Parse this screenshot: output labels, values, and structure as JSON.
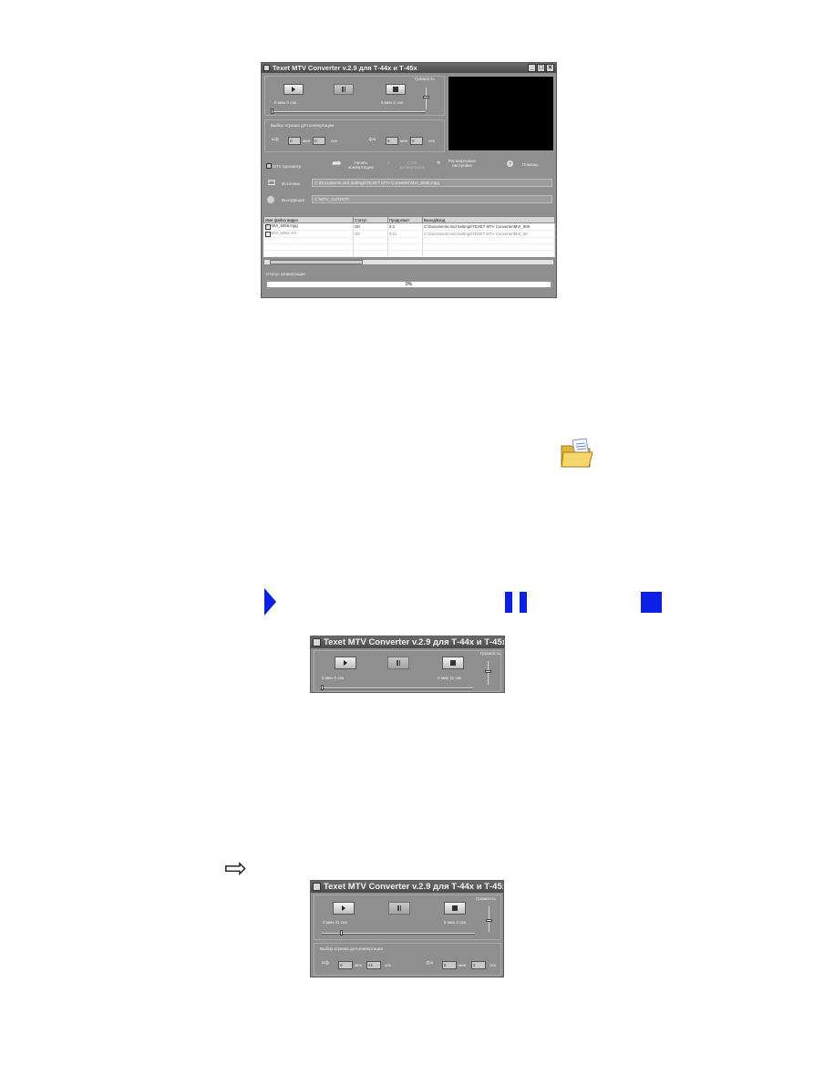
{
  "main_window": {
    "title": "Texet MTV Converter v.2.9 для Т-44х и Т-45х",
    "window_controls": {
      "minimize": "_",
      "maximize": "□",
      "close": "×"
    },
    "volume_label": "Громкость",
    "position_time": "0 мин 0 сек",
    "duration_time": "5 мин 2 сек",
    "segment_label": "Выбор отрезка для конвертации",
    "start_min": "0",
    "start_sec": "0",
    "end_min": "5",
    "end_sec": "2",
    "unit_min": "мин",
    "unit_sec": "сек",
    "mtv_preview": "MTV просмотр",
    "start_conversion": "Начать конвертацию",
    "stop_conversion": "Стоп конвертация",
    "advanced_settings": "Расширенные настройки",
    "help": "Помощь",
    "source_label": "Источник",
    "source_path": "C:\\Documents and Settings\\TEXET MTV Converter\\MVI_5056.mpg",
    "output_label": "Выходящая",
    "output_path": "C:\\MTV_OUTPUT\\",
    "table": {
      "headers": [
        "Имя файла видео",
        "Статус",
        "Продолжит",
        "Выход/вход"
      ],
      "rows": [
        {
          "name": "MVI_5056.mpg",
          "status": "OK",
          "duration": "5:2",
          "path": "C:\\Documents and Settings\\TEXET MTV Converter\\MVI_505"
        },
        {
          "name": "MVI_5054.AVI",
          "status": "OK",
          "duration": "0:11",
          "path": "C:\\Documents and Settings\\TEXET MTV Converter\\MVI_50"
        }
      ]
    },
    "status_label": "Статус конвертации",
    "progress_text": "0%",
    "progress_value": 0
  },
  "crop_player": {
    "title": "Texet MTV Converter v.2.9 для Т-44х и Т-45х",
    "volume_label": "Громкость",
    "position_time": "0 мин 0 сек",
    "duration_time": "0 мин 11 сек"
  },
  "crop_segment": {
    "title": "Texet MTV Converter v.2.9 для Т-44х и Т-45х",
    "volume_label": "Громкость",
    "position_time": "0 мин 41 сек",
    "duration_time": "5 мин 2 сек",
    "segment_label": "Выбор отрезка для конвертации",
    "start_min": "0",
    "start_sec": "41",
    "end_min": "5",
    "end_sec": "2",
    "unit_min": "мин",
    "unit_sec": "сек"
  },
  "icons": {
    "folder": "folder-icon",
    "play": "play-icon",
    "pause": "pause-icon",
    "stop": "stop-icon",
    "arrow": "arrow-right-icon"
  },
  "colors": {
    "accent_blue": "#0a20e6",
    "window_gray": "#8f8f8f",
    "titlebar": "#4b4b4b"
  }
}
